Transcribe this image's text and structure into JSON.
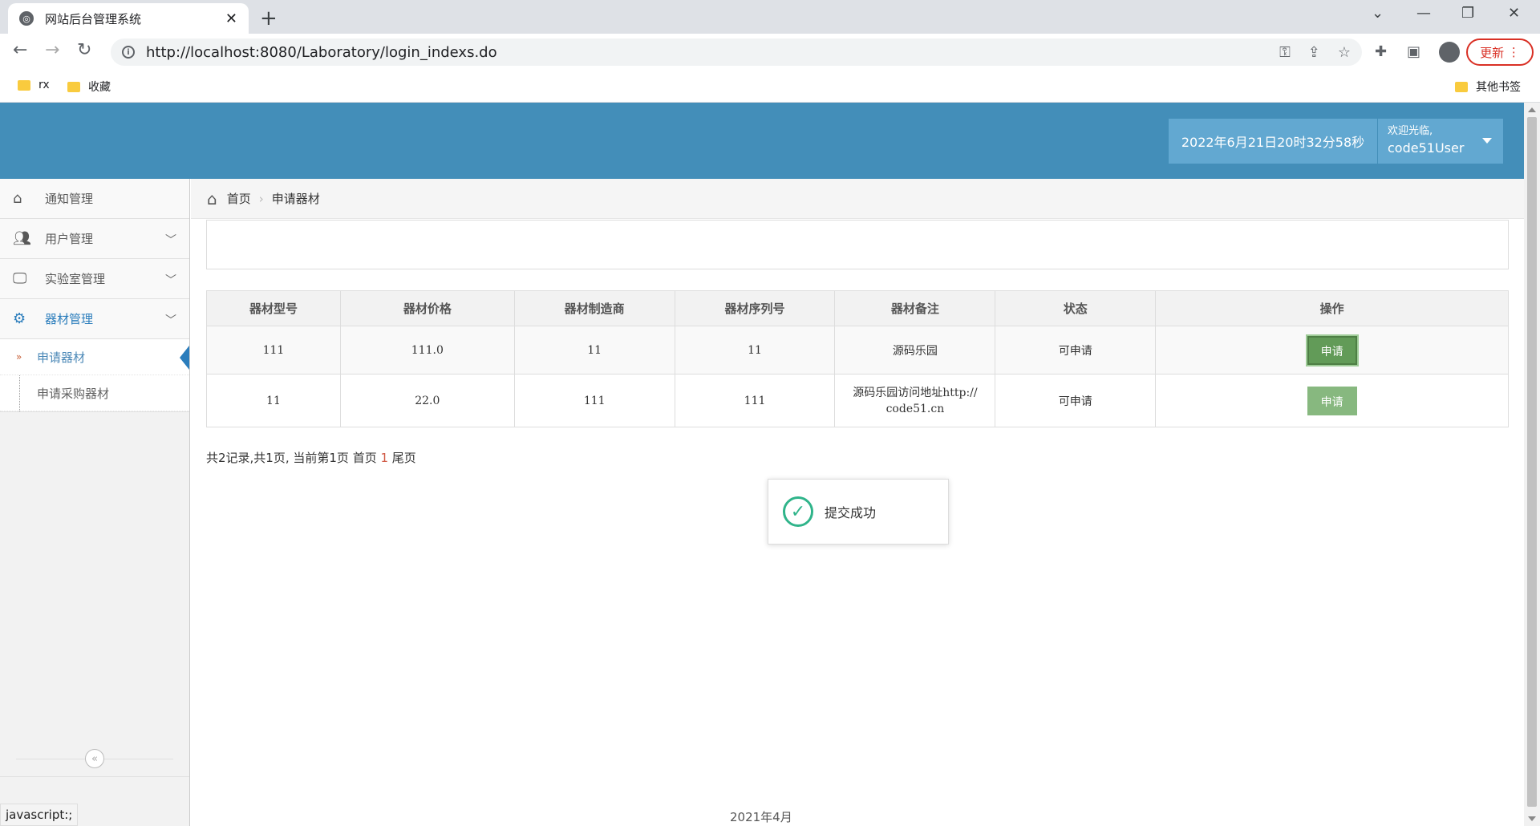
{
  "browser": {
    "tab_title": "网站后台管理系统",
    "url": "http://localhost:8080/Laboratory/login_indexs.do",
    "update_label": "更新",
    "bookmarks": [
      "rx",
      "收藏"
    ],
    "other_bookmarks": "其他书签"
  },
  "header": {
    "datetime": "2022年6月21日20时32分58秒",
    "welcome": "欢迎光临,",
    "username": "code51User"
  },
  "sidebar": {
    "items": [
      {
        "label": "通知管理",
        "icon": "home-icon"
      },
      {
        "label": "用户管理",
        "icon": "users-icon"
      },
      {
        "label": "实验室管理",
        "icon": "desktop-icon"
      },
      {
        "label": "器材管理",
        "icon": "cogs-icon"
      }
    ],
    "subitems": [
      {
        "label": "申请器材"
      },
      {
        "label": "申请采购器材"
      }
    ]
  },
  "breadcrumb": {
    "home": "首页",
    "current": "申请器材"
  },
  "table": {
    "headers": [
      "器材型号",
      "器材价格",
      "器材制造商",
      "器材序列号",
      "器材备注",
      "状态",
      "操作"
    ],
    "rows": [
      [
        "111",
        "111.0",
        "11",
        "11",
        "源码乐园",
        "可申请",
        "申请"
      ],
      [
        "11",
        "22.0",
        "111",
        "111",
        "源码乐园访问地址http://code51.cn",
        "可申请",
        "申请"
      ]
    ]
  },
  "pager": {
    "prefix": "共2记录,共1页, 当前第1页 首页 ",
    "current": "1",
    "suffix": " 尾页"
  },
  "toast": {
    "message": "提交成功"
  },
  "footer": "2021年4月",
  "statusbar": "javascript:;",
  "colors": {
    "header_bg": "#438eb9",
    "accent": "#2b7dbc",
    "button_green": "#87b87f",
    "success": "#2fb48a"
  }
}
